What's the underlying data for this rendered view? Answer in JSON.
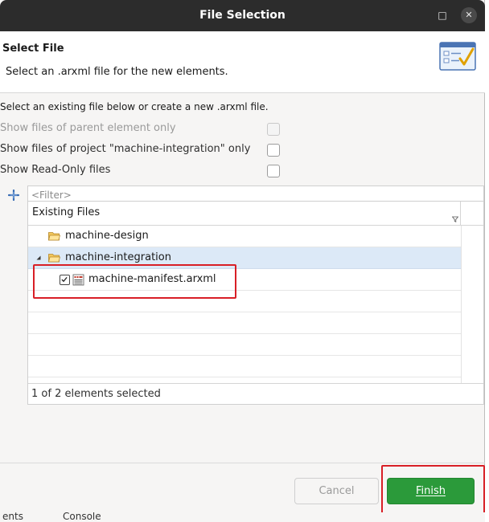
{
  "window": {
    "title": "File Selection",
    "minimize_glyph": "□",
    "close_glyph": "✕"
  },
  "header": {
    "title": "Select File",
    "description": "Select an .arxml file for the new elements.",
    "icon": "wizard-checklist-icon"
  },
  "intro": "Select an existing file below or create a new .arxml file.",
  "options": [
    {
      "label": "Show files of parent element only",
      "checked": false,
      "enabled": false
    },
    {
      "label": "Show files of project \"machine-integration\" only",
      "checked": false,
      "enabled": true
    },
    {
      "label": "Show Read-Only files",
      "checked": false,
      "enabled": true
    }
  ],
  "filter": {
    "placeholder": "<Filter>",
    "value": ""
  },
  "tree": {
    "column_header": "Existing Files",
    "rows": [
      {
        "label": "machine-design",
        "type": "folder",
        "expanded": false
      },
      {
        "label": "machine-integration",
        "type": "folder",
        "expanded": true,
        "selected": true
      },
      {
        "label": "machine-manifest.arxml",
        "type": "file",
        "checked": true
      }
    ]
  },
  "status": "1 of 2 elements selected",
  "buttons": {
    "cancel": "Cancel",
    "finish": "Finish"
  },
  "background_tabs": {
    "left": "ents",
    "right": "Console"
  },
  "colors": {
    "accent_green": "#2b9a3a",
    "highlight_red": "#d81f26",
    "selection_blue": "#dce9f7"
  }
}
